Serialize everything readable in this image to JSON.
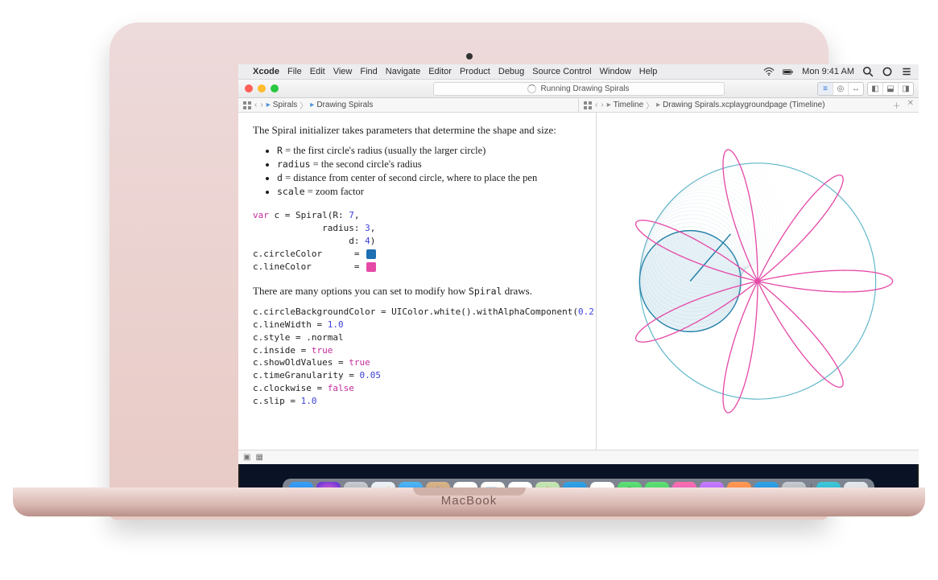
{
  "device_label": "MacBook",
  "menubar": {
    "app": "Xcode",
    "items": [
      "File",
      "Edit",
      "View",
      "Find",
      "Navigate",
      "Editor",
      "Product",
      "Debug",
      "Source Control",
      "Window",
      "Help"
    ],
    "clock": "Mon 9:41 AM"
  },
  "toolbar": {
    "status": "Running Drawing Spirals"
  },
  "jumpbar_left": {
    "items": [
      "Spirals",
      "Drawing Spirals"
    ]
  },
  "jumpbar_right": {
    "items": [
      "Timeline",
      "Drawing Spirals.xcplaygroundpage (Timeline)"
    ]
  },
  "doc": {
    "p1": "The Spiral initializer takes parameters that determine the shape and size:",
    "b1_code": "R",
    "b1_text": " = the first circle's radius (usually the larger circle)",
    "b2_code": "radius",
    "b2_text": " = the second circle's radius",
    "b3_code": "d",
    "b3_text": " = distance from center of second circle, where to place the pen",
    "b4_code": "scale",
    "b4_text": " = zoom factor",
    "p2_a": "There are many options you can set to modify how ",
    "p2_code": "Spiral",
    "p2_b": " draws."
  },
  "code": {
    "block1_l1_a": "var",
    "block1_l1_b": " c = Spiral(R: ",
    "block1_l1_c": "7",
    "block1_l1_d": ",",
    "block1_l2_a": "             radius: ",
    "block1_l2_b": "3",
    "block1_l2_c": ",",
    "block1_l3_a": "                  d: ",
    "block1_l3_b": "4",
    "block1_l3_c": ")",
    "block1_l4": "c.circleColor      = ",
    "block1_l5": "c.lineColor        = ",
    "circle_color": "#1e6fb3",
    "line_color": "#e64aa8",
    "block2_l1": "c.circleBackgroundColor = UIColor.white().withAlphaComponent(",
    "block2_l1_num": "0.2",
    "block2_l1_end": ")",
    "block2_l2_a": "c.lineWidth = ",
    "block2_l2_b": "1.0",
    "block2_l3": "c.style = .normal",
    "block2_l4_a": "c.inside = ",
    "block2_l4_b": "true",
    "block2_l5_a": "c.showOldValues = ",
    "block2_l5_b": "true",
    "block2_l6_a": "c.timeGranularity = ",
    "block2_l6_b": "0.05",
    "block2_l7_a": "c.clockwise = ",
    "block2_l7_b": "false",
    "block2_l8_a": "c.slip = ",
    "block2_l8_b": "1.0"
  },
  "chart_data": {
    "type": "spirograph",
    "R": 7,
    "radius": 3,
    "d": 4,
    "circle_color": "#5cb6c9",
    "inner_circle_color": "#1e7fa8",
    "line_color": "#e64aa8",
    "petals": 7,
    "inside": true
  },
  "dock": {
    "items": [
      {
        "name": "finder",
        "bg": "linear-gradient(#3aa0f4,#1d6fe0)",
        "glyph": "☺"
      },
      {
        "name": "siri",
        "bg": "radial-gradient(circle,#ff6ad5,#4b2bd6)",
        "glyph": "◉"
      },
      {
        "name": "launchpad",
        "bg": "linear-gradient(#c9cdd2,#8e949c)",
        "glyph": "⊞"
      },
      {
        "name": "safari",
        "bg": "linear-gradient(#eef2f6,#cfd5dc)",
        "glyph": "🧭"
      },
      {
        "name": "mail",
        "bg": "linear-gradient(#4fb7f5,#1d78e6)",
        "glyph": "✉"
      },
      {
        "name": "contacts",
        "bg": "linear-gradient(#d9b58b,#b8885a)",
        "glyph": "👤"
      },
      {
        "name": "calendar",
        "bg": "#fff",
        "glyph": "11",
        "text": "#e03131"
      },
      {
        "name": "notes",
        "bg": "linear-gradient(#fff,#f4e9c8)",
        "glyph": "📝"
      },
      {
        "name": "reminders",
        "bg": "#fff",
        "glyph": "☑"
      },
      {
        "name": "maps",
        "bg": "linear-gradient(#c9e5b4,#8fd082)",
        "glyph": "📍"
      },
      {
        "name": "xcode",
        "bg": "linear-gradient(#30a4e6,#1a6fc9)",
        "glyph": "🔨"
      },
      {
        "name": "photos",
        "bg": "#fff",
        "glyph": "✿",
        "text": "#e85d9a"
      },
      {
        "name": "messages",
        "bg": "linear-gradient(#5fe077,#2bb94a)",
        "glyph": "💬"
      },
      {
        "name": "facetime",
        "bg": "linear-gradient(#5fe077,#2bb94a)",
        "glyph": "📹"
      },
      {
        "name": "itunes",
        "bg": "linear-gradient(#ff6ea8,#b84cf0)",
        "glyph": "♫"
      },
      {
        "name": "podcasts",
        "bg": "linear-gradient(#c77dff,#8a3ff0)",
        "glyph": "🎙"
      },
      {
        "name": "ibooks",
        "bg": "linear-gradient(#ff9a56,#ff6a2c)",
        "glyph": "📖"
      },
      {
        "name": "appstore",
        "bg": "linear-gradient(#30a4e6,#1a6fc9)",
        "glyph": "A"
      },
      {
        "name": "preferences",
        "bg": "linear-gradient(#c9cdd2,#8e949c)",
        "glyph": "⚙"
      }
    ],
    "after_sep": [
      {
        "name": "downloads",
        "bg": "linear-gradient(#3ec8d8,#22a3c0)",
        "glyph": "⬇"
      },
      {
        "name": "trash",
        "bg": "linear-gradient(#e6e9ec,#c4c9cf)",
        "glyph": "🗑"
      }
    ]
  }
}
